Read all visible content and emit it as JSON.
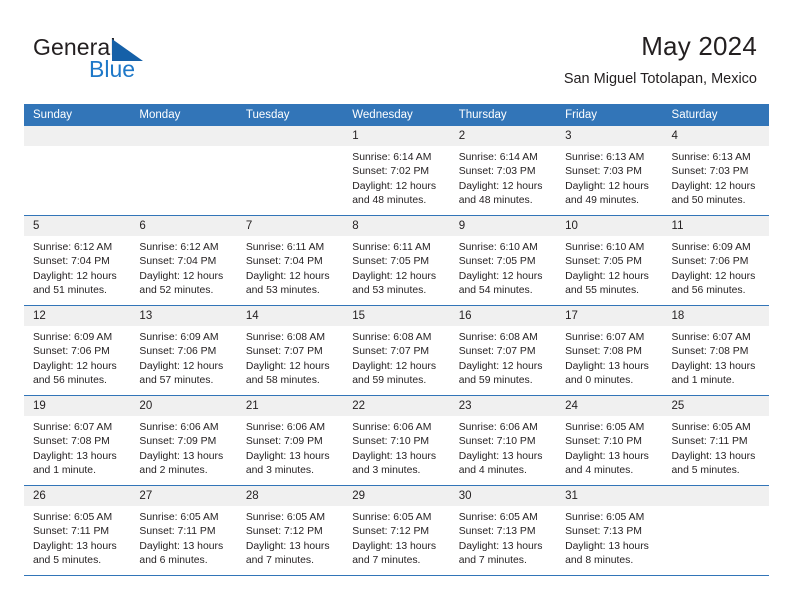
{
  "brand": {
    "name_top": "General",
    "name_bottom": "Blue",
    "accent_color": "#1560a8",
    "blue_text_color": "#1e78c8"
  },
  "header": {
    "title": "May 2024",
    "subtitle": "San Miguel Totolapan, Mexico"
  },
  "calendar": {
    "header_bg": "#3275b8",
    "header_text_color": "#ffffff",
    "daynum_strip_bg": "#f0f0f0",
    "weekdays": [
      "Sunday",
      "Monday",
      "Tuesday",
      "Wednesday",
      "Thursday",
      "Friday",
      "Saturday"
    ],
    "weeks": [
      [
        {
          "day": "",
          "empty": true
        },
        {
          "day": "",
          "empty": true
        },
        {
          "day": "",
          "empty": true
        },
        {
          "day": "1",
          "sunrise": "Sunrise: 6:14 AM",
          "sunset": "Sunset: 7:02 PM",
          "daylight_1": "Daylight: 12 hours",
          "daylight_2": "and 48 minutes."
        },
        {
          "day": "2",
          "sunrise": "Sunrise: 6:14 AM",
          "sunset": "Sunset: 7:03 PM",
          "daylight_1": "Daylight: 12 hours",
          "daylight_2": "and 48 minutes."
        },
        {
          "day": "3",
          "sunrise": "Sunrise: 6:13 AM",
          "sunset": "Sunset: 7:03 PM",
          "daylight_1": "Daylight: 12 hours",
          "daylight_2": "and 49 minutes."
        },
        {
          "day": "4",
          "sunrise": "Sunrise: 6:13 AM",
          "sunset": "Sunset: 7:03 PM",
          "daylight_1": "Daylight: 12 hours",
          "daylight_2": "and 50 minutes."
        }
      ],
      [
        {
          "day": "5",
          "sunrise": "Sunrise: 6:12 AM",
          "sunset": "Sunset: 7:04 PM",
          "daylight_1": "Daylight: 12 hours",
          "daylight_2": "and 51 minutes."
        },
        {
          "day": "6",
          "sunrise": "Sunrise: 6:12 AM",
          "sunset": "Sunset: 7:04 PM",
          "daylight_1": "Daylight: 12 hours",
          "daylight_2": "and 52 minutes."
        },
        {
          "day": "7",
          "sunrise": "Sunrise: 6:11 AM",
          "sunset": "Sunset: 7:04 PM",
          "daylight_1": "Daylight: 12 hours",
          "daylight_2": "and 53 minutes."
        },
        {
          "day": "8",
          "sunrise": "Sunrise: 6:11 AM",
          "sunset": "Sunset: 7:05 PM",
          "daylight_1": "Daylight: 12 hours",
          "daylight_2": "and 53 minutes."
        },
        {
          "day": "9",
          "sunrise": "Sunrise: 6:10 AM",
          "sunset": "Sunset: 7:05 PM",
          "daylight_1": "Daylight: 12 hours",
          "daylight_2": "and 54 minutes."
        },
        {
          "day": "10",
          "sunrise": "Sunrise: 6:10 AM",
          "sunset": "Sunset: 7:05 PM",
          "daylight_1": "Daylight: 12 hours",
          "daylight_2": "and 55 minutes."
        },
        {
          "day": "11",
          "sunrise": "Sunrise: 6:09 AM",
          "sunset": "Sunset: 7:06 PM",
          "daylight_1": "Daylight: 12 hours",
          "daylight_2": "and 56 minutes."
        }
      ],
      [
        {
          "day": "12",
          "sunrise": "Sunrise: 6:09 AM",
          "sunset": "Sunset: 7:06 PM",
          "daylight_1": "Daylight: 12 hours",
          "daylight_2": "and 56 minutes."
        },
        {
          "day": "13",
          "sunrise": "Sunrise: 6:09 AM",
          "sunset": "Sunset: 7:06 PM",
          "daylight_1": "Daylight: 12 hours",
          "daylight_2": "and 57 minutes."
        },
        {
          "day": "14",
          "sunrise": "Sunrise: 6:08 AM",
          "sunset": "Sunset: 7:07 PM",
          "daylight_1": "Daylight: 12 hours",
          "daylight_2": "and 58 minutes."
        },
        {
          "day": "15",
          "sunrise": "Sunrise: 6:08 AM",
          "sunset": "Sunset: 7:07 PM",
          "daylight_1": "Daylight: 12 hours",
          "daylight_2": "and 59 minutes."
        },
        {
          "day": "16",
          "sunrise": "Sunrise: 6:08 AM",
          "sunset": "Sunset: 7:07 PM",
          "daylight_1": "Daylight: 12 hours",
          "daylight_2": "and 59 minutes."
        },
        {
          "day": "17",
          "sunrise": "Sunrise: 6:07 AM",
          "sunset": "Sunset: 7:08 PM",
          "daylight_1": "Daylight: 13 hours",
          "daylight_2": "and 0 minutes."
        },
        {
          "day": "18",
          "sunrise": "Sunrise: 6:07 AM",
          "sunset": "Sunset: 7:08 PM",
          "daylight_1": "Daylight: 13 hours",
          "daylight_2": "and 1 minute."
        }
      ],
      [
        {
          "day": "19",
          "sunrise": "Sunrise: 6:07 AM",
          "sunset": "Sunset: 7:08 PM",
          "daylight_1": "Daylight: 13 hours",
          "daylight_2": "and 1 minute."
        },
        {
          "day": "20",
          "sunrise": "Sunrise: 6:06 AM",
          "sunset": "Sunset: 7:09 PM",
          "daylight_1": "Daylight: 13 hours",
          "daylight_2": "and 2 minutes."
        },
        {
          "day": "21",
          "sunrise": "Sunrise: 6:06 AM",
          "sunset": "Sunset: 7:09 PM",
          "daylight_1": "Daylight: 13 hours",
          "daylight_2": "and 3 minutes."
        },
        {
          "day": "22",
          "sunrise": "Sunrise: 6:06 AM",
          "sunset": "Sunset: 7:10 PM",
          "daylight_1": "Daylight: 13 hours",
          "daylight_2": "and 3 minutes."
        },
        {
          "day": "23",
          "sunrise": "Sunrise: 6:06 AM",
          "sunset": "Sunset: 7:10 PM",
          "daylight_1": "Daylight: 13 hours",
          "daylight_2": "and 4 minutes."
        },
        {
          "day": "24",
          "sunrise": "Sunrise: 6:05 AM",
          "sunset": "Sunset: 7:10 PM",
          "daylight_1": "Daylight: 13 hours",
          "daylight_2": "and 4 minutes."
        },
        {
          "day": "25",
          "sunrise": "Sunrise: 6:05 AM",
          "sunset": "Sunset: 7:11 PM",
          "daylight_1": "Daylight: 13 hours",
          "daylight_2": "and 5 minutes."
        }
      ],
      [
        {
          "day": "26",
          "sunrise": "Sunrise: 6:05 AM",
          "sunset": "Sunset: 7:11 PM",
          "daylight_1": "Daylight: 13 hours",
          "daylight_2": "and 5 minutes."
        },
        {
          "day": "27",
          "sunrise": "Sunrise: 6:05 AM",
          "sunset": "Sunset: 7:11 PM",
          "daylight_1": "Daylight: 13 hours",
          "daylight_2": "and 6 minutes."
        },
        {
          "day": "28",
          "sunrise": "Sunrise: 6:05 AM",
          "sunset": "Sunset: 7:12 PM",
          "daylight_1": "Daylight: 13 hours",
          "daylight_2": "and 7 minutes."
        },
        {
          "day": "29",
          "sunrise": "Sunrise: 6:05 AM",
          "sunset": "Sunset: 7:12 PM",
          "daylight_1": "Daylight: 13 hours",
          "daylight_2": "and 7 minutes."
        },
        {
          "day": "30",
          "sunrise": "Sunrise: 6:05 AM",
          "sunset": "Sunset: 7:13 PM",
          "daylight_1": "Daylight: 13 hours",
          "daylight_2": "and 7 minutes."
        },
        {
          "day": "31",
          "sunrise": "Sunrise: 6:05 AM",
          "sunset": "Sunset: 7:13 PM",
          "daylight_1": "Daylight: 13 hours",
          "daylight_2": "and 8 minutes."
        },
        {
          "day": "",
          "empty": true
        }
      ]
    ]
  }
}
